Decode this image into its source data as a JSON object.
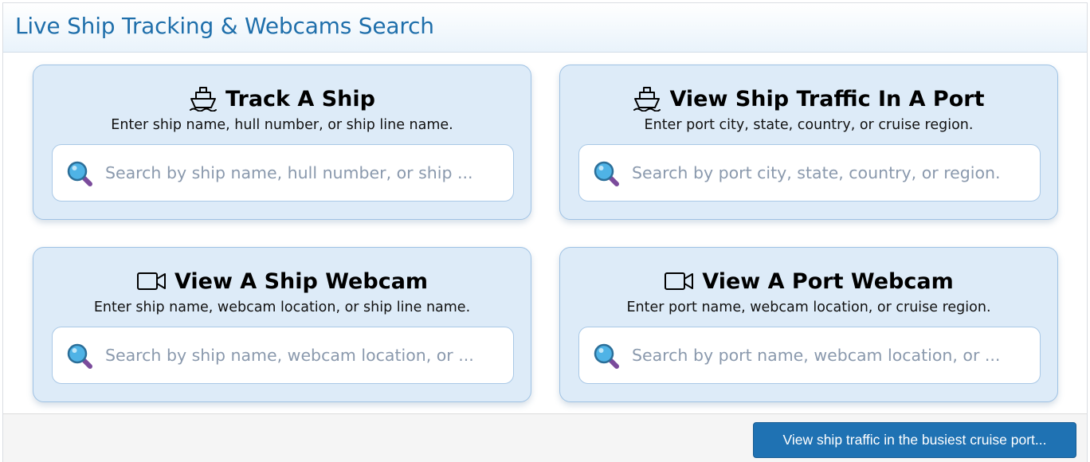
{
  "header": {
    "title": "Live Ship Tracking & Webcams Search"
  },
  "cards": [
    {
      "icon": "ship-icon",
      "title": "Track A Ship",
      "subtitle": "Enter ship name, hull number, or ship line name.",
      "placeholder": "Search by ship name, hull number, or ship ...",
      "value": ""
    },
    {
      "icon": "ship-icon",
      "title": "View Ship Traffic In A Port",
      "subtitle": "Enter port city, state, country, or cruise region.",
      "placeholder": "Search by port city, state, country, or region.",
      "value": ""
    },
    {
      "icon": "video-camera-icon",
      "title": "View A Ship Webcam",
      "subtitle": "Enter ship name, webcam location, or ship line name.",
      "placeholder": "Search by ship name, webcam location, or ...",
      "value": ""
    },
    {
      "icon": "video-camera-icon",
      "title": "View A Port Webcam",
      "subtitle": "Enter port name, webcam location, or cruise region.",
      "placeholder": "Search by port name, webcam location, or ...",
      "value": ""
    }
  ],
  "footer": {
    "button_label": "View ship traffic in the busiest cruise port..."
  },
  "colors": {
    "title": "#1f6fab",
    "card_bg": "#ddebf8",
    "card_border": "#9fc2e4",
    "button": "#1f72b3",
    "magnifier_lens": "#4fb3e6",
    "magnifier_handle": "#7b4b9b"
  }
}
